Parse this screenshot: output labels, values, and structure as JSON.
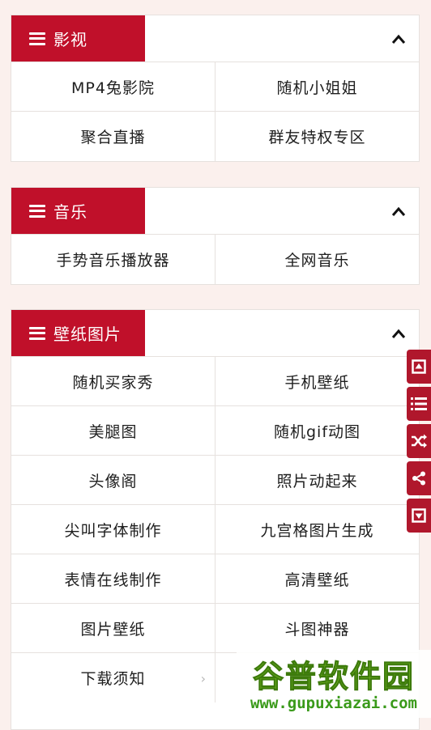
{
  "sections": [
    {
      "title": "影视",
      "items": [
        "MP4兔影院",
        "随机小姐姐",
        "聚合直播",
        "群友特权专区"
      ]
    },
    {
      "title": "音乐",
      "items": [
        "手势音乐播放器",
        "全网音乐"
      ]
    },
    {
      "title": "壁纸图片",
      "items": [
        "随机买家秀",
        "手机壁纸",
        "美腿图",
        "随机gif动图",
        "头像阁",
        "照片动起来",
        "尖叫字体制作",
        "九宫格图片生成",
        "表情在线制作",
        "高清壁纸",
        "图片壁纸",
        "斗图神器",
        "下载须知"
      ]
    }
  ],
  "sidebar": [
    "scroll-top-icon",
    "list-icon",
    "shuffle-icon",
    "share-icon",
    "scroll-bottom-icon"
  ],
  "watermark": {
    "title": "谷普软件园",
    "url": "www.gupuxiazai.com"
  },
  "colors": {
    "accent": "#c0102a",
    "background": "#fbf0ed"
  }
}
